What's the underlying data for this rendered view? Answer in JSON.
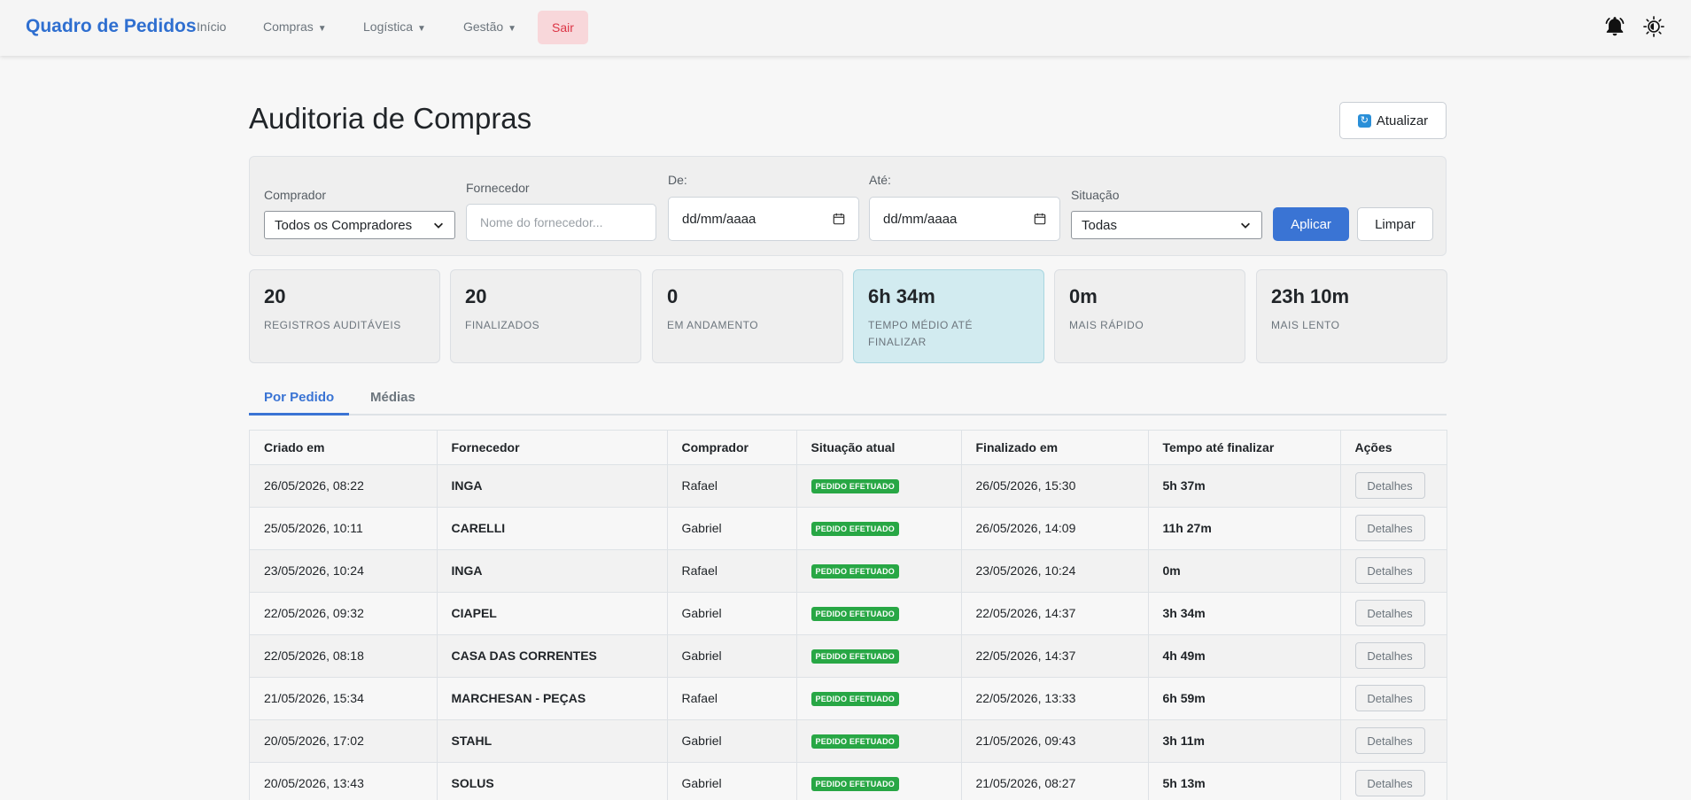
{
  "navbar": {
    "brand": "Quadro de Pedidos",
    "items": [
      {
        "label": "Início",
        "has_caret": false
      },
      {
        "label": "Compras",
        "has_caret": true
      },
      {
        "label": "Logística",
        "has_caret": true
      },
      {
        "label": "Gestão",
        "has_caret": true
      }
    ],
    "logout_label": "Sair",
    "icons": [
      "bell-icon",
      "sun-icon"
    ]
  },
  "header": {
    "title": "Auditoria de Compras",
    "refresh_label": "Atualizar"
  },
  "filters": {
    "buyer": {
      "label": "Comprador",
      "value": "Todos os Compradores"
    },
    "supplier": {
      "label": "Fornecedor",
      "placeholder": "Nome do fornecedor..."
    },
    "from": {
      "label": "De:",
      "value": "dd/mm/aaaa"
    },
    "to": {
      "label": "Até:",
      "value": "dd/mm/aaaa"
    },
    "status": {
      "label": "Situação",
      "value": "Todas"
    },
    "apply_label": "Aplicar",
    "clear_label": "Limpar"
  },
  "stats": [
    {
      "value": "20",
      "label": "REGISTROS AUDITÁVEIS"
    },
    {
      "value": "20",
      "label": "FINALIZADOS"
    },
    {
      "value": "0",
      "label": "EM ANDAMENTO"
    },
    {
      "value": "6h 34m",
      "label": "TEMPO MÉDIO ATÉ FINALIZAR"
    },
    {
      "value": "0m",
      "label": "MAIS RÁPIDO"
    },
    {
      "value": "23h 10m",
      "label": "MAIS LENTO"
    }
  ],
  "tabs": [
    {
      "label": "Por Pedido",
      "active": true
    },
    {
      "label": "Médias",
      "active": false
    }
  ],
  "table": {
    "headers": [
      "Criado em",
      "Fornecedor",
      "Comprador",
      "Situação atual",
      "Finalizado em",
      "Tempo até finalizar",
      "Ações"
    ],
    "rows": [
      {
        "created": "26/05/2026, 08:22",
        "supplier": "INGA",
        "buyer": "Rafael",
        "status": "PEDIDO EFETUADO",
        "finished": "26/05/2026, 15:30",
        "duration": "5h 37m",
        "action": "Detalhes"
      },
      {
        "created": "25/05/2026, 10:11",
        "supplier": "CARELLI",
        "buyer": "Gabriel",
        "status": "PEDIDO EFETUADO",
        "finished": "26/05/2026, 14:09",
        "duration": "11h 27m",
        "action": "Detalhes"
      },
      {
        "created": "23/05/2026, 10:24",
        "supplier": "INGA",
        "buyer": "Rafael",
        "status": "PEDIDO EFETUADO",
        "finished": "23/05/2026, 10:24",
        "duration": "0m",
        "action": "Detalhes"
      },
      {
        "created": "22/05/2026, 09:32",
        "supplier": "CIAPEL",
        "buyer": "Gabriel",
        "status": "PEDIDO EFETUADO",
        "finished": "22/05/2026, 14:37",
        "duration": "3h 34m",
        "action": "Detalhes"
      },
      {
        "created": "22/05/2026, 08:18",
        "supplier": "CASA DAS CORRENTES",
        "buyer": "Gabriel",
        "status": "PEDIDO EFETUADO",
        "finished": "22/05/2026, 14:37",
        "duration": "4h 49m",
        "action": "Detalhes"
      },
      {
        "created": "21/05/2026, 15:34",
        "supplier": "MARCHESAN - PEÇAS",
        "buyer": "Rafael",
        "status": "PEDIDO EFETUADO",
        "finished": "22/05/2026, 13:33",
        "duration": "6h 59m",
        "action": "Detalhes"
      },
      {
        "created": "20/05/2026, 17:02",
        "supplier": "STAHL",
        "buyer": "Gabriel",
        "status": "PEDIDO EFETUADO",
        "finished": "21/05/2026, 09:43",
        "duration": "3h 11m",
        "action": "Detalhes"
      },
      {
        "created": "20/05/2026, 13:43",
        "supplier": "SOLUS",
        "buyer": "Gabriel",
        "status": "PEDIDO EFETUADO",
        "finished": "21/05/2026, 08:27",
        "duration": "5h 13m",
        "action": "Detalhes"
      }
    ]
  },
  "colors": {
    "brand": "#2f6fd0",
    "primary": "#3a74d4",
    "success": "#28a745",
    "danger_bg": "#f8d7da",
    "danger_text": "#dc3545",
    "highlight_card": "#d2ebf0"
  }
}
